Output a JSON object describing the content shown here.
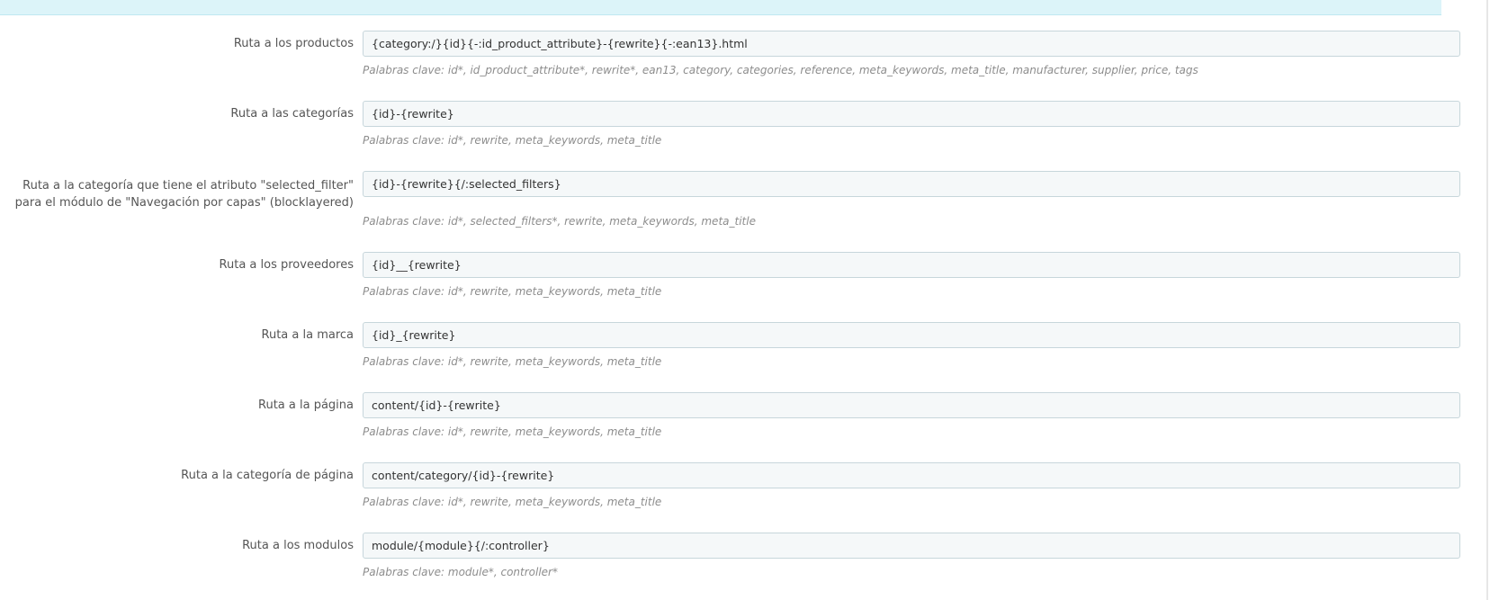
{
  "rows": [
    {
      "label": "Ruta a los productos",
      "value": "{category:/}{id}{-:id_product_attribute}-{rewrite}{-:ean13}.html",
      "help": "Palabras clave: id*, id_product_attribute*, rewrite*, ean13, category, categories, reference, meta_keywords, meta_title, manufacturer, supplier, price, tags"
    },
    {
      "label": "Ruta a las categorías",
      "value": "{id}-{rewrite}",
      "help": "Palabras clave: id*, rewrite, meta_keywords, meta_title"
    },
    {
      "label": "Ruta a la categoría que tiene el atributo \"selected_filter\" para el módulo de \"Navegación por capas\" (blocklayered)",
      "value": "{id}-{rewrite}{/:selected_filters}",
      "help": "Palabras clave: id*, selected_filters*, rewrite, meta_keywords, meta_title"
    },
    {
      "label": "Ruta a los proveedores",
      "value": "{id}__{rewrite}",
      "help": "Palabras clave: id*, rewrite, meta_keywords, meta_title"
    },
    {
      "label": "Ruta a la marca",
      "value": "{id}_{rewrite}",
      "help": "Palabras clave: id*, rewrite, meta_keywords, meta_title"
    },
    {
      "label": "Ruta a la página",
      "value": "content/{id}-{rewrite}",
      "help": "Palabras clave: id*, rewrite, meta_keywords, meta_title"
    },
    {
      "label": "Ruta a la categoría de página",
      "value": "content/category/{id}-{rewrite}",
      "help": "Palabras clave: id*, rewrite, meta_keywords, meta_title"
    },
    {
      "label": "Ruta a los modulos",
      "value": "module/{module}{/:controller}",
      "help": "Palabras clave: module*, controller*"
    }
  ]
}
